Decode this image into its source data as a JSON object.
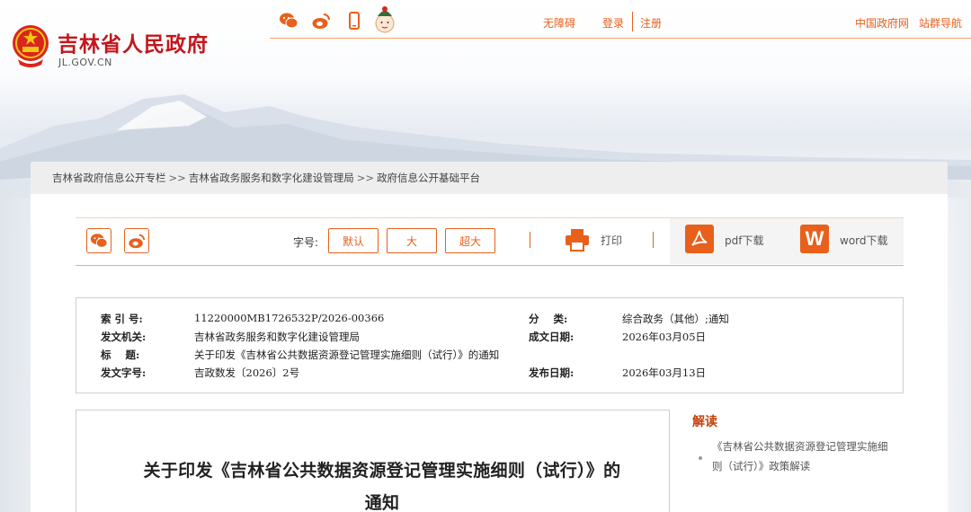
{
  "header": {
    "site_title": "吉林省人民政府",
    "site_domain": "JL.GOV.CN",
    "accessibility": "无障碍",
    "login": "登录",
    "register": "注册",
    "china_gov": "中国政府网",
    "site_nav": "站群导航",
    "social_icons": [
      "wechat-icon",
      "weibo-icon",
      "mobile-icon",
      "mascot-icon"
    ],
    "accent_color": "#e8601c",
    "title_color": "#c4161c"
  },
  "breadcrumb": {
    "items": [
      "吉林省政府信息公开专栏",
      "吉林省政务服务和数字化建设管理局",
      "政府信息公开基础平台"
    ],
    "separator": ">>"
  },
  "toolbar": {
    "share_icons": [
      "wechat-share-icon",
      "weibo-share-icon"
    ],
    "font_size_label": "字号:",
    "font_default": "默认",
    "font_large": "大",
    "font_xlarge": "超大",
    "print": "打印",
    "pdf_download": "pdf下载",
    "word_download": "word下载",
    "word_glyph": "W"
  },
  "info": {
    "index_label": "索 引 号:",
    "index_value": "11220000MB1726532P/2026-00366",
    "issuer_label": "发文机关:",
    "issuer_value": "吉林省政务服务和数字化建设管理局",
    "title_label": "标    题:",
    "title_value": "关于印发《吉林省公共数据资源登记管理实施细则（试行）》的通知",
    "docno_label": "发文字号:",
    "docno_value": "吉政数发〔2026〕2号",
    "category_label": "分    类:",
    "category_value": "综合政务（其他）;通知",
    "created_label": "成文日期:",
    "created_value": "2026年03月05日",
    "published_label": "发布日期:",
    "published_value": "2026年03月13日"
  },
  "article": {
    "title_line1": "关于印发《吉林省公共数据资源登记管理实施细则（试行）》的",
    "title_line2": "通知"
  },
  "sidebar": {
    "heading": "解读",
    "link_line1": "《吉林省公共数据资源登记管理实施细",
    "link_line2": "则（试行）》政策解读"
  }
}
